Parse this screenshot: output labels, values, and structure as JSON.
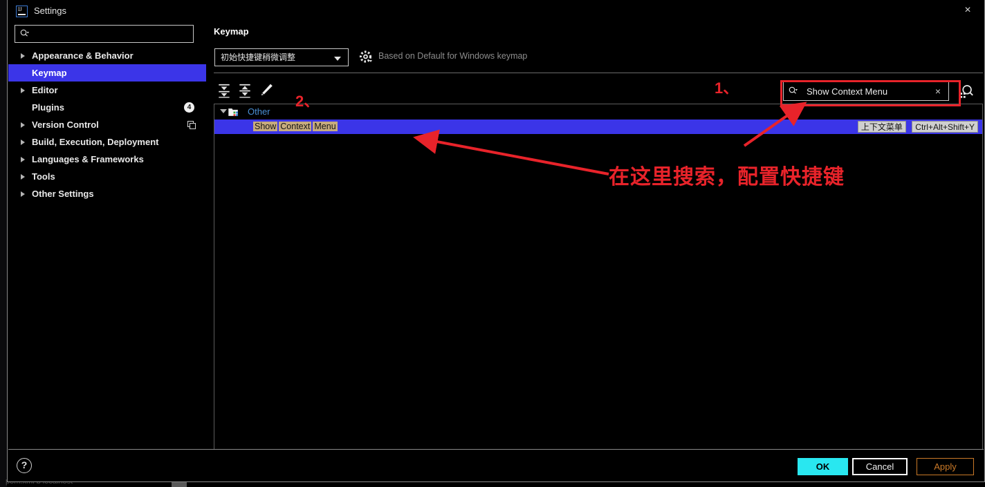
{
  "window": {
    "title": "Settings",
    "logo_text": "IJ",
    "close_icon": "×"
  },
  "sidebar": {
    "search": {
      "value": "",
      "placeholder": "",
      "icon": "search-icon"
    },
    "items": [
      {
        "label": "Appearance & Behavior",
        "arrow": true,
        "selected": false,
        "badge": "",
        "icon": ""
      },
      {
        "label": "Keymap",
        "arrow": false,
        "selected": true,
        "badge": "",
        "icon": ""
      },
      {
        "label": "Editor",
        "arrow": true,
        "selected": false,
        "badge": "",
        "icon": ""
      },
      {
        "label": "Plugins",
        "arrow": false,
        "selected": false,
        "badge": "4",
        "icon": ""
      },
      {
        "label": "Version Control",
        "arrow": true,
        "selected": false,
        "badge": "",
        "icon": "copy-icon"
      },
      {
        "label": "Build, Execution, Deployment",
        "arrow": true,
        "selected": false,
        "badge": "",
        "icon": ""
      },
      {
        "label": "Languages & Frameworks",
        "arrow": true,
        "selected": false,
        "badge": "",
        "icon": ""
      },
      {
        "label": "Tools",
        "arrow": true,
        "selected": false,
        "badge": "",
        "icon": ""
      },
      {
        "label": "Other Settings",
        "arrow": true,
        "selected": false,
        "badge": "",
        "icon": ""
      }
    ]
  },
  "main": {
    "panel_title": "Keymap",
    "keymap_select_value": "初始快捷键稍微调整",
    "gear_label": "gear-icon",
    "based_on_text": "Based on Default for Windows keymap",
    "toolbar_icons": [
      "expand-all-icon",
      "collapse-all-icon",
      "edit-shortcut-icon"
    ],
    "keymap_search": {
      "value": "Show Context Menu",
      "placeholder": "",
      "search_icon": "search-icon",
      "clear_icon": "×",
      "find_by_shortcut_icon": "find-by-shortcut-icon"
    },
    "tree": {
      "group": {
        "label": "Other",
        "expanded": true,
        "icon": "folder-icon"
      },
      "action": {
        "name_parts": [
          "Show",
          "Context",
          "Menu"
        ],
        "full_name": "Show Context Menu",
        "selected": true,
        "shortcuts": [
          "上下文菜单",
          "Ctrl+Alt+Shift+Y"
        ]
      }
    }
  },
  "annotations": {
    "marker_1": "1、",
    "marker_2": "2、",
    "note": "在这里搜索，配置快捷键",
    "color": "#e8232a"
  },
  "footer": {
    "help_icon": "?",
    "ok_label": "OK",
    "cancel_label": "Cancel",
    "apply_label": "Apply",
    "ok_color": "#29e7f0",
    "apply_color": "#cb7a28"
  },
  "background": {
    "bottom_text": "pom.xml  b  localhost"
  }
}
